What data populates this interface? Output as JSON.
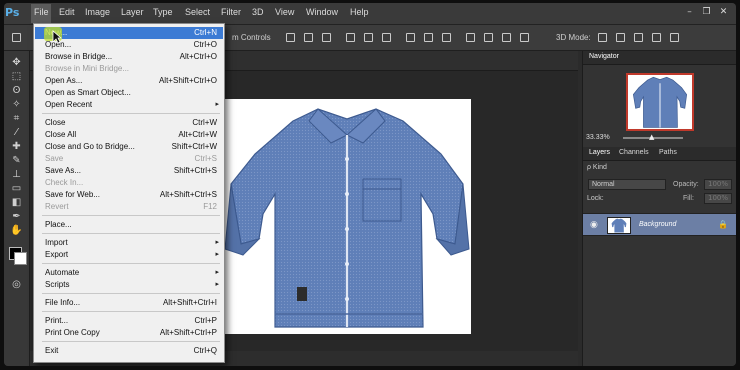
{
  "app": {
    "logo": "Ps"
  },
  "menubar": {
    "items": [
      "File",
      "Edit",
      "Image",
      "Layer",
      "Type",
      "Select",
      "Filter",
      "3D",
      "View",
      "Window",
      "Help"
    ]
  },
  "window_controls": {
    "minimize": "–",
    "restore": "❐",
    "close": "✕"
  },
  "options_bar": {
    "transform_controls_label": "m Controls",
    "mode_3d_label": "3D Mode:"
  },
  "file_menu": [
    {
      "label": "New...",
      "shortcut": "Ctrl+N",
      "state": "highlighted"
    },
    {
      "label": "Open...",
      "shortcut": "Ctrl+O"
    },
    {
      "label": "Browse in Bridge...",
      "shortcut": "Alt+Ctrl+O"
    },
    {
      "label": "Browse in Mini Bridge...",
      "shortcut": "",
      "state": "disabled"
    },
    {
      "label": "Open As...",
      "shortcut": "Alt+Shift+Ctrl+O"
    },
    {
      "label": "Open as Smart Object...",
      "shortcut": ""
    },
    {
      "label": "Open Recent",
      "shortcut": "",
      "submenu": true
    },
    {
      "label": "Close",
      "shortcut": "Ctrl+W"
    },
    {
      "label": "Close All",
      "shortcut": "Alt+Ctrl+W"
    },
    {
      "label": "Close and Go to Bridge...",
      "shortcut": "Shift+Ctrl+W"
    },
    {
      "label": "Save",
      "shortcut": "Ctrl+S",
      "state": "disabled"
    },
    {
      "label": "Save As...",
      "shortcut": "Shift+Ctrl+S"
    },
    {
      "label": "Check In...",
      "shortcut": "",
      "state": "disabled"
    },
    {
      "label": "Save for Web...",
      "shortcut": "Alt+Shift+Ctrl+S"
    },
    {
      "label": "Revert",
      "shortcut": "F12",
      "state": "disabled"
    },
    {
      "label": "Place...",
      "shortcut": ""
    },
    {
      "label": "Import",
      "shortcut": "",
      "submenu": true
    },
    {
      "label": "Export",
      "shortcut": "",
      "submenu": true
    },
    {
      "label": "Automate",
      "shortcut": "",
      "submenu": true
    },
    {
      "label": "Scripts",
      "shortcut": "",
      "submenu": true
    },
    {
      "label": "File Info...",
      "shortcut": "Alt+Shift+Ctrl+I"
    },
    {
      "label": "Print...",
      "shortcut": "Ctrl+P"
    },
    {
      "label": "Print One Copy",
      "shortcut": "Alt+Shift+Ctrl+P"
    },
    {
      "label": "Exit",
      "shortcut": "Ctrl+Q"
    }
  ],
  "navigator": {
    "tab": "Navigator",
    "zoom": "33.33%"
  },
  "layers_panel": {
    "tabs": [
      "Layers",
      "Channels",
      "Paths"
    ],
    "filter_kind": "ρ Kind",
    "blend_mode": "Normal",
    "opacity_label": "Opacity:",
    "opacity_value": "100%",
    "lock_label": "Lock:",
    "fill_label": "Fill:",
    "fill_value": "100%",
    "layer_name": "Background"
  },
  "colors": {
    "highlight": "#3c7bd4",
    "layer_selected": "#6c7fa5",
    "shirt": "#5f7fb8"
  }
}
